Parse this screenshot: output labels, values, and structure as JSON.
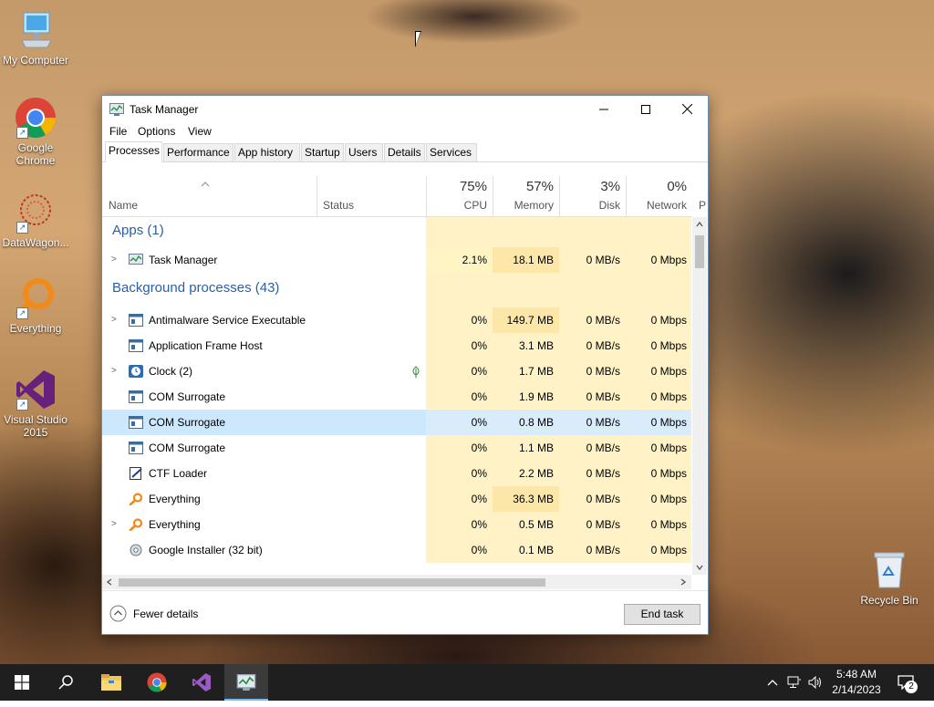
{
  "desktop": {
    "icons": [
      {
        "label": "My Computer"
      },
      {
        "label": "Google Chrome"
      },
      {
        "label": "DataWagon..."
      },
      {
        "label": "Everything"
      },
      {
        "label": "Visual Studio 2015"
      },
      {
        "label": "Recycle Bin"
      }
    ]
  },
  "window": {
    "title": "Task Manager",
    "menu": [
      "File",
      "Options",
      "View"
    ],
    "tabs": [
      "Processes",
      "Performance",
      "App history",
      "Startup",
      "Users",
      "Details",
      "Services"
    ],
    "active_tab": "Processes",
    "columns": {
      "name": "Name",
      "status": "Status",
      "cpu": {
        "pct": "75%",
        "label": "CPU"
      },
      "memory": {
        "pct": "57%",
        "label": "Memory"
      },
      "disk": {
        "pct": "3%",
        "label": "Disk"
      },
      "network": {
        "pct": "0%",
        "label": "Network"
      },
      "extra": "P"
    },
    "groups": {
      "apps": "Apps (1)",
      "background": "Background processes (43)"
    },
    "processes": [
      {
        "name": "Task Manager",
        "cpu": "2.1%",
        "mem": "18.1 MB",
        "disk": "0 MB/s",
        "net": "0 Mbps"
      },
      {
        "name": "Antimalware Service Executable",
        "cpu": "0%",
        "mem": "149.7 MB",
        "disk": "0 MB/s",
        "net": "0 Mbps"
      },
      {
        "name": "Application Frame Host",
        "cpu": "0%",
        "mem": "3.1 MB",
        "disk": "0 MB/s",
        "net": "0 Mbps"
      },
      {
        "name": "Clock (2)",
        "cpu": "0%",
        "mem": "1.7 MB",
        "disk": "0 MB/s",
        "net": "0 Mbps"
      },
      {
        "name": "COM Surrogate",
        "cpu": "0%",
        "mem": "1.9 MB",
        "disk": "0 MB/s",
        "net": "0 Mbps"
      },
      {
        "name": "COM Surrogate",
        "cpu": "0%",
        "mem": "0.8 MB",
        "disk": "0 MB/s",
        "net": "0 Mbps"
      },
      {
        "name": "COM Surrogate",
        "cpu": "0%",
        "mem": "1.1 MB",
        "disk": "0 MB/s",
        "net": "0 Mbps"
      },
      {
        "name": "CTF Loader",
        "cpu": "0%",
        "mem": "2.2 MB",
        "disk": "0 MB/s",
        "net": "0 Mbps"
      },
      {
        "name": "Everything",
        "cpu": "0%",
        "mem": "36.3 MB",
        "disk": "0 MB/s",
        "net": "0 Mbps"
      },
      {
        "name": "Everything",
        "cpu": "0%",
        "mem": "0.5 MB",
        "disk": "0 MB/s",
        "net": "0 Mbps"
      },
      {
        "name": "Google Installer (32 bit)",
        "cpu": "0%",
        "mem": "0.1 MB",
        "disk": "0 MB/s",
        "net": "0 Mbps"
      }
    ],
    "fewer_details": "Fewer details",
    "end_task": "End task"
  },
  "taskbar": {
    "time": "5:48 AM",
    "date": "2/14/2023",
    "notification_count": "2"
  },
  "colors": {
    "accent": "#2a5fa8",
    "selected_row": "#cce8ff",
    "cpu_highlight": "#fff4c4",
    "memory_highlight": "#fde7a8",
    "taskbar": "#1f1f20"
  }
}
